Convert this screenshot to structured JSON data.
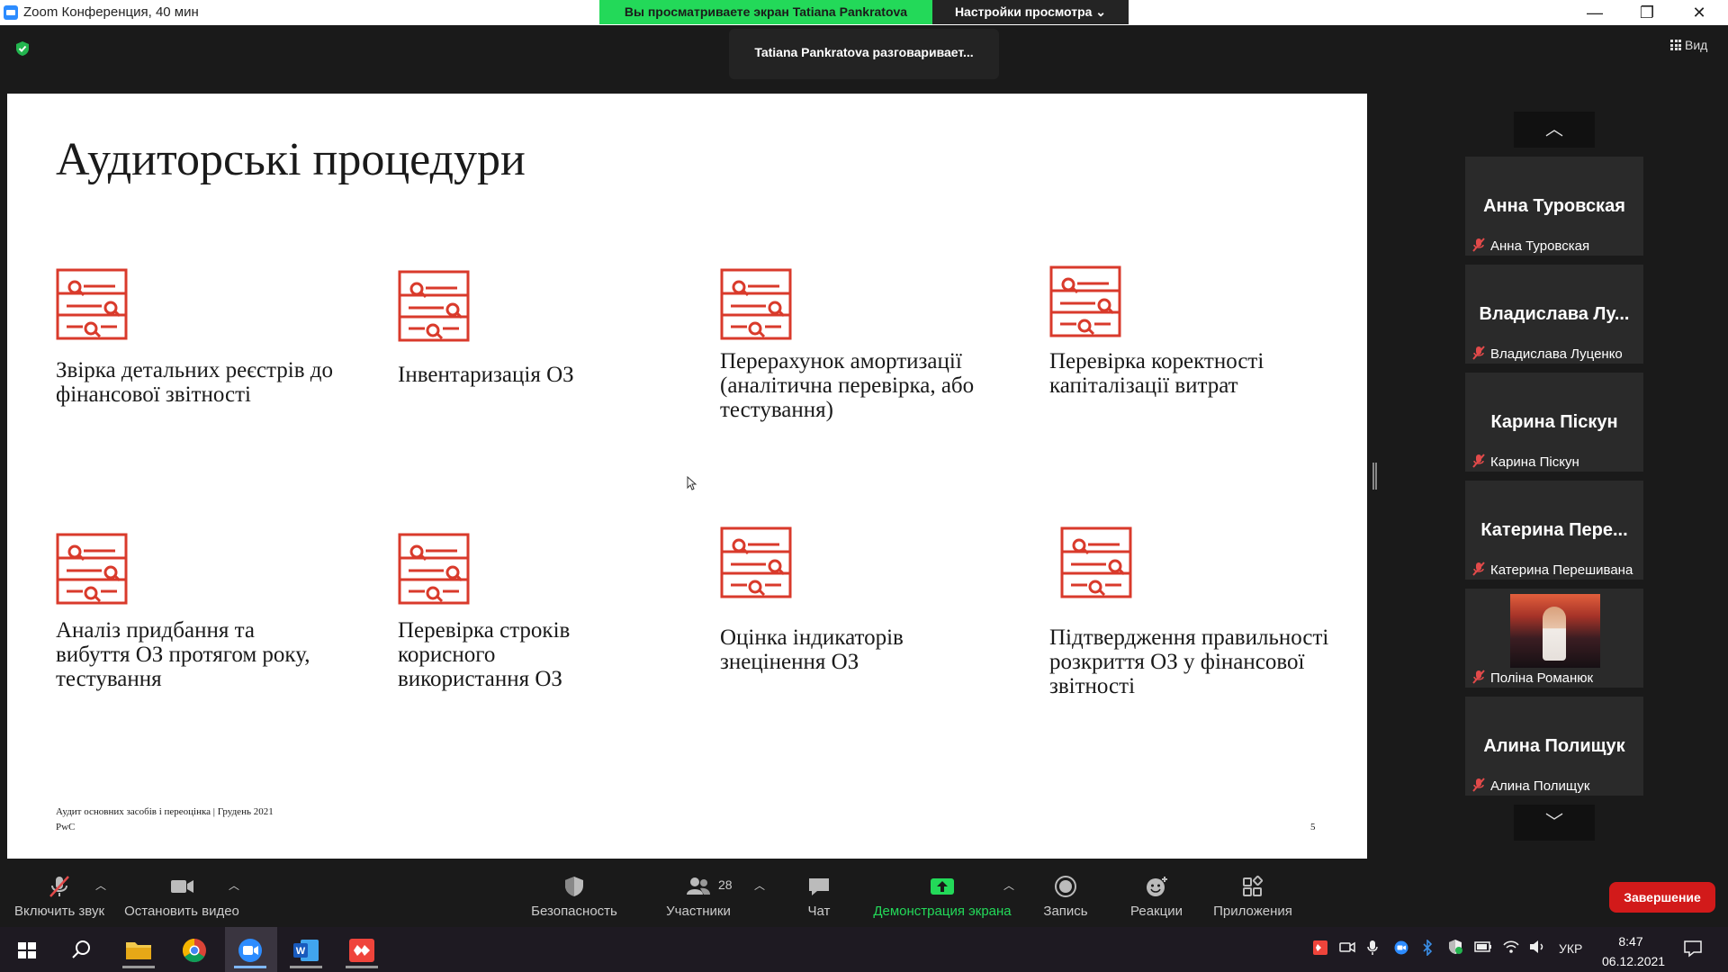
{
  "window": {
    "title": "Zoom Конференция, 40 мин",
    "share_banner": "Вы просматриваете экран Tatiana Pankratova",
    "view_settings": "Настройки просмотра ⌄",
    "speaking": "Tatiana Pankratova разговаривает...",
    "view_button": "Вид"
  },
  "slide": {
    "title": "Аудиторські процедури",
    "procedures": [
      "Звірка детальних реєстрів до фінансової звітності",
      "Інвентаризація ОЗ",
      "Перерахунок амортизації (аналітична перевірка, або тестування)",
      "Перевірка коректності капіталізації витрат",
      "Аналіз придбання та вибуття ОЗ протягом року, тестування",
      "Перевірка строків корисного використання ОЗ",
      "Оцінка індикаторів знецінення ОЗ",
      "Підтвердження правильності розкриття ОЗ у фінансової звітності"
    ],
    "footer_line1": "Аудит основних засобів і переоцінка | Грудень 2021",
    "footer_line2": "PwC",
    "page_number": "5",
    "icon_color": "#d93a2b"
  },
  "participants": [
    {
      "big": "Анна Туровская",
      "small": "Анна Туровская"
    },
    {
      "big": "Владислава  Лу...",
      "small": "Владислава Луценко"
    },
    {
      "big": "Карина Піскун",
      "small": "Карина Піскун"
    },
    {
      "big": "Катерина  Пере...",
      "small": "Катерина Перешивана"
    },
    {
      "big": "",
      "small": "Поліна Романюк"
    },
    {
      "big": "Алина Полищук",
      "small": "Алина Полищук"
    }
  ],
  "toolbar": {
    "unmute": "Включить звук",
    "stop_video": "Остановить видео",
    "security": "Безопасность",
    "participants": "Участники",
    "participants_count": "28",
    "chat": "Чат",
    "share": "Демонстрация экрана",
    "record": "Запись",
    "reactions": "Реакции",
    "apps": "Приложения",
    "end": "Завершение"
  },
  "taskbar": {
    "language": "УКР",
    "time": "8:47",
    "date": "06.12.2021"
  }
}
